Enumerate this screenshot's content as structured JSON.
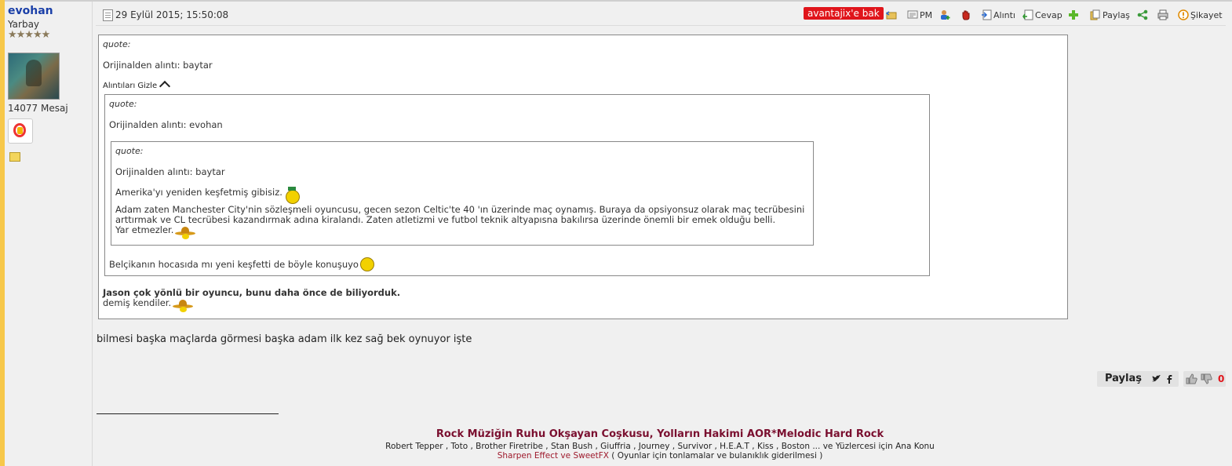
{
  "user": {
    "name": "evohan",
    "rank": "Yarbay",
    "stars": "★★★★★",
    "message_count": "14077 Mesaj"
  },
  "post": {
    "date": "29 Eylül 2015; 15:50:08",
    "toolbar": {
      "badge": "avantajix'e bak",
      "pm": "PM",
      "quote": "Alıntı",
      "reply": "Cevap",
      "share": "Paylaş",
      "report": "Şikayet"
    },
    "outer_quote": {
      "label": "quote:",
      "origin": "Orijinalden alıntı: baytar",
      "hide_label": "Alıntıları Gizle",
      "closing_bold": "Jason çok yönlü bir oyuncu, bunu daha önce de biliyorduk.",
      "closing_text": "demiş kendiler."
    },
    "middle_quote": {
      "label": "quote:",
      "origin": "Orijinalden alıntı: evohan",
      "text": "Belçikanın hocasıda mı yeni keşfetti de böyle konuşuyo"
    },
    "inner_quote": {
      "label": "quote:",
      "origin": "Orijinalden alıntı: baytar",
      "line1": "Amerika'yı yeniden keşfetmiş gibisiz.",
      "line2": "Adam zaten Manchester City'nin sözleşmeli oyuncusu, gecen sezon Celtic'te 40 'ın üzerinde maç oynamış. Buraya da opsiyonsuz olarak maç tecrübesini",
      "line3": "arttırmak ve CL tecrübesi kazandırmak adına kiralandı. Zaten atletizmi ve futbol teknik altyapısna bakılırsa üzerinde önemli bir emek olduğu belli.",
      "line4": "Yar etmezler."
    },
    "body": "bilmesi başka maçlarda görmesi başka adam ilk kez sağ bek oynuyor işte",
    "share_label": "Paylaş",
    "like_count": "0"
  },
  "signature": {
    "title": "Rock Müziğin Ruhu Okşayan Coşkusu, Yolların Hakimi AOR*Melodic Hard Rock",
    "line2": "Robert Tepper , Toto , Brother Firetribe , Stan Bush , Giuffria , Journey , Survivor , H.E.A.T , Kiss , Boston ... ve Yüzlercesi için Ana Konu",
    "link": "Sharpen Effect ve SweetFX",
    "line3_rest": " ( Oyunlar için tonlamalar ve bulanıklık giderilmesi )"
  },
  "colors": {
    "accent_red": "#e0151b",
    "username_blue": "#1a3fa8",
    "signature_title": "#7a0f2f"
  }
}
